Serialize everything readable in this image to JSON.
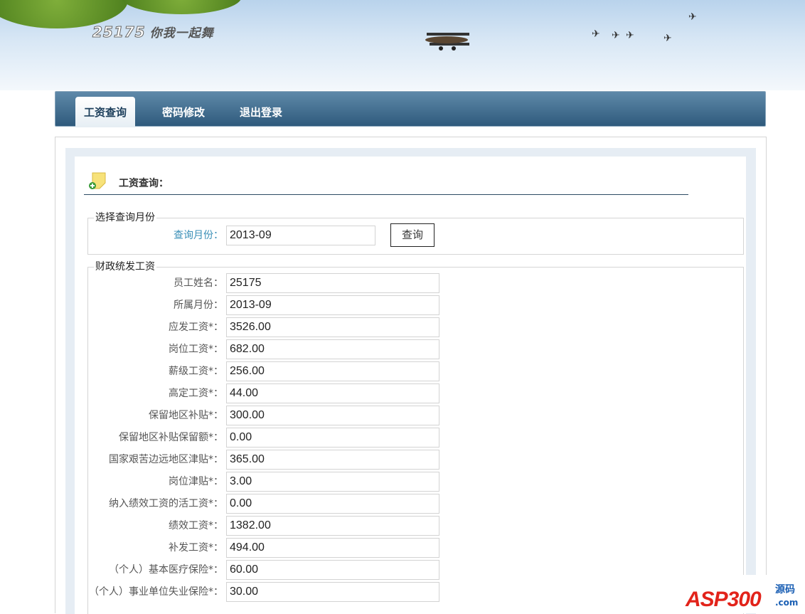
{
  "header": {
    "logo_number": "25175",
    "logo_slogan": "你我一起舞"
  },
  "nav": {
    "tabs": [
      {
        "label": "工资查询",
        "active": true
      },
      {
        "label": "密码修改"
      },
      {
        "label": "退出登录"
      }
    ]
  },
  "page": {
    "title": "工资查询："
  },
  "query": {
    "legend": "选择查询月份",
    "label": "查询月份：",
    "value": "2013-09",
    "button": "查询"
  },
  "salary": {
    "legend": "财政统发工资",
    "fields": [
      {
        "label": "员工姓名：",
        "value": "25175"
      },
      {
        "label": "所属月份：",
        "value": "2013-09"
      },
      {
        "label": "应发工资*：",
        "value": "3526.00"
      },
      {
        "label": "岗位工资*：",
        "value": "682.00"
      },
      {
        "label": "薪级工资*：",
        "value": "256.00"
      },
      {
        "label": "高定工资*：",
        "value": "44.00"
      },
      {
        "label": "保留地区补贴*：",
        "value": "300.00"
      },
      {
        "label": "保留地区补贴保留额*：",
        "value": "0.00"
      },
      {
        "label": "国家艰苦边远地区津贴*：",
        "value": "365.00"
      },
      {
        "label": "岗位津贴*：",
        "value": "3.00"
      },
      {
        "label": "纳入绩效工资的活工资*：",
        "value": "0.00"
      },
      {
        "label": "绩效工资*：",
        "value": "1382.00"
      },
      {
        "label": "补发工资*：",
        "value": "494.00"
      },
      {
        "label": "（个人）基本医疗保险*：",
        "value": "60.00"
      },
      {
        "label": "（个人）事业单位失业保险*：",
        "value": "30.00"
      }
    ]
  },
  "watermark": {
    "brand": "ASP300",
    "suffix": "源码",
    "domain": ".com"
  }
}
